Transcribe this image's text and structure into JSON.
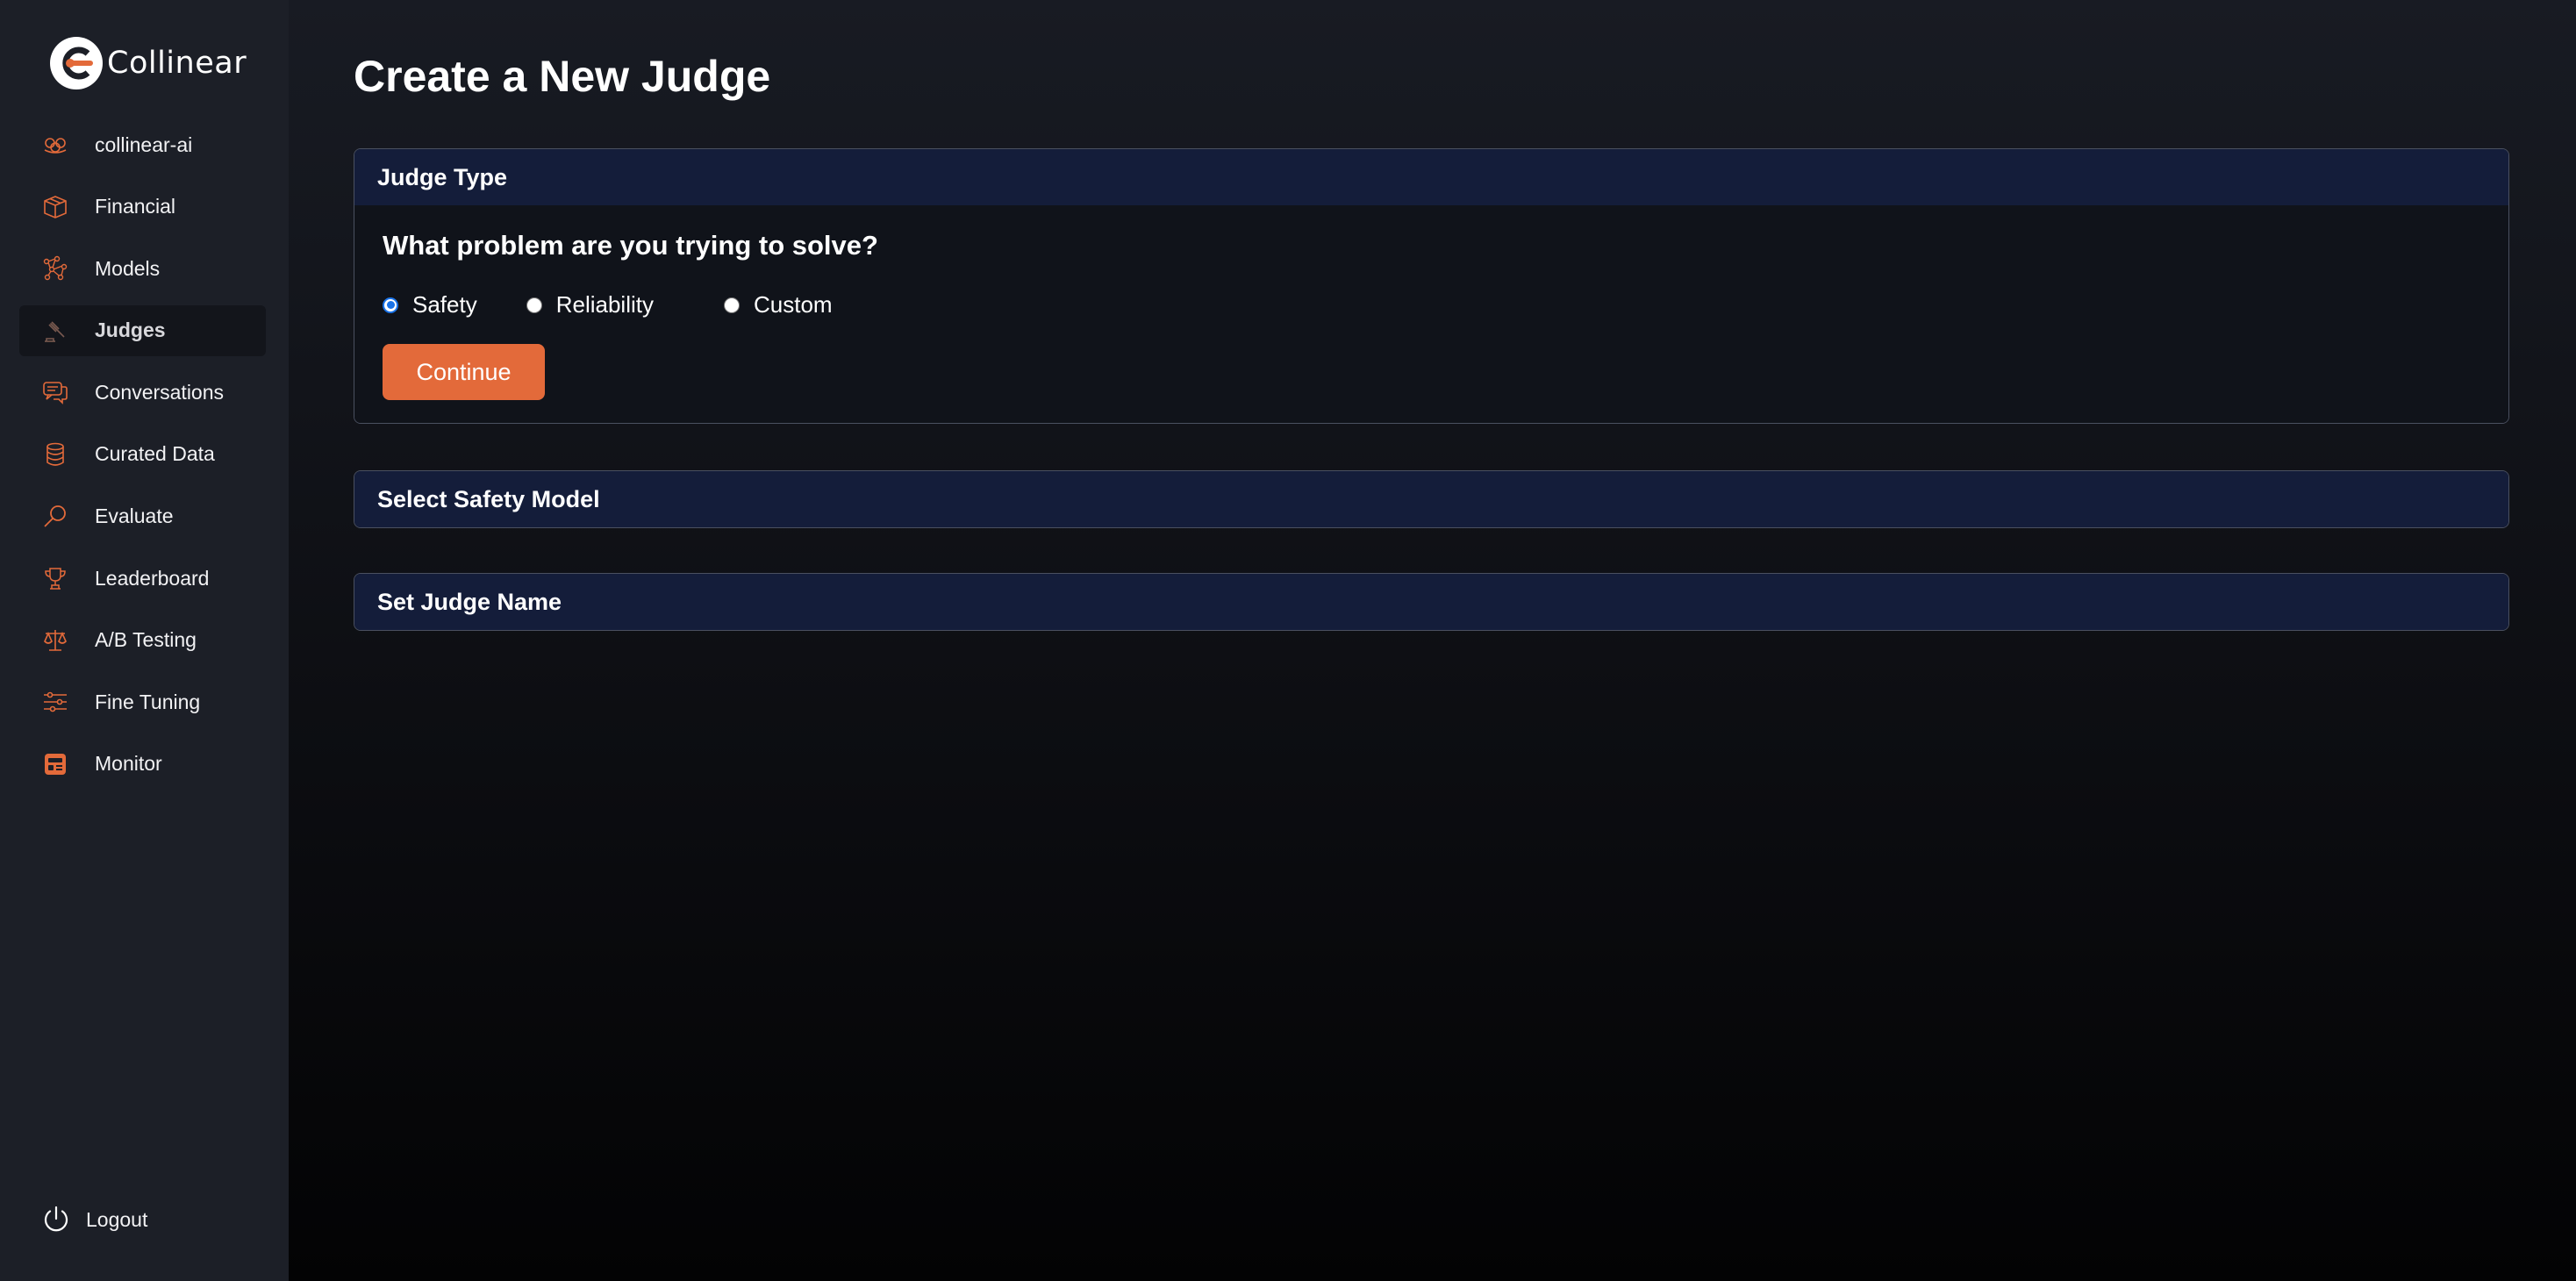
{
  "brand": {
    "name": "Collinear",
    "accent": "#e36a3a"
  },
  "sidebar": {
    "items": [
      {
        "label": "collinear-ai",
        "icon": "organization-icon",
        "active": false
      },
      {
        "label": "Financial",
        "icon": "box-icon",
        "active": false
      },
      {
        "label": "Models",
        "icon": "network-icon",
        "active": false
      },
      {
        "label": "Judges",
        "icon": "gavel-icon",
        "active": true
      },
      {
        "label": "Conversations",
        "icon": "chat-bubbles-icon",
        "active": false
      },
      {
        "label": "Curated Data",
        "icon": "database-icon",
        "active": false
      },
      {
        "label": "Evaluate",
        "icon": "magnifier-icon",
        "active": false
      },
      {
        "label": "Leaderboard",
        "icon": "trophy-icon",
        "active": false
      },
      {
        "label": "A/B Testing",
        "icon": "scales-icon",
        "active": false
      },
      {
        "label": "Fine Tuning",
        "icon": "sliders-icon",
        "active": false
      },
      {
        "label": "Monitor",
        "icon": "monitor-icon",
        "active": false
      }
    ],
    "logout_label": "Logout"
  },
  "main": {
    "title": "Create a New Judge",
    "judge_type": {
      "header": "Judge Type",
      "question": "What problem are you trying to solve?",
      "options": [
        {
          "label": "Safety",
          "checked": true
        },
        {
          "label": "Reliability",
          "checked": false
        },
        {
          "label": "Custom",
          "checked": false
        }
      ],
      "continue_label": "Continue"
    },
    "select_model_header": "Select Safety Model",
    "set_name_header": "Set Judge Name"
  }
}
